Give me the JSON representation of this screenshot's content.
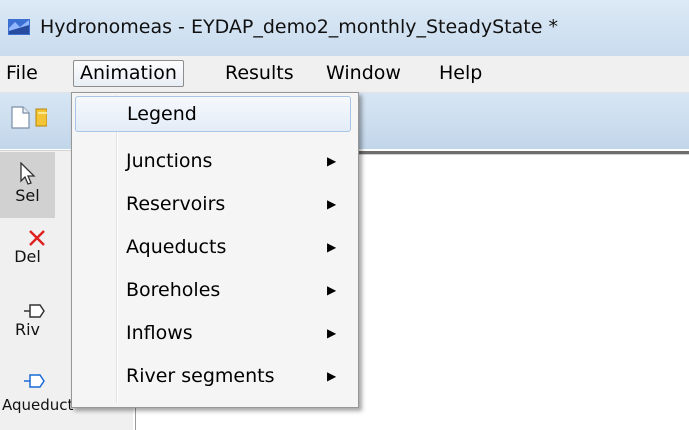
{
  "window": {
    "title": "Hydronomeas - EYDAP_demo2_monthly_SteadyState *",
    "icon": "app-logo-icon"
  },
  "menubar": {
    "items": [
      {
        "label": "File"
      },
      {
        "label": "Animation"
      },
      {
        "label": "Results"
      },
      {
        "label": "Window"
      },
      {
        "label": "Help"
      }
    ],
    "open_menu": "Animation"
  },
  "toolbar": {
    "icons": [
      "new-document-icon",
      "open-folder-icon"
    ]
  },
  "sidebar": {
    "tools": [
      {
        "label": "Sel",
        "icon": "pointer-arrow-icon"
      },
      {
        "label": "Del",
        "icon": "red-x-icon"
      },
      {
        "label": "Riv",
        "icon": "river-node-icon"
      },
      {
        "label": "Aqueduct",
        "icon": "aqueduct-node-icon"
      }
    ]
  },
  "animation_menu": {
    "items": [
      {
        "label": "Legend",
        "submenu": false,
        "highlighted": true
      },
      {
        "label": "Junctions",
        "submenu": true,
        "highlighted": false
      },
      {
        "label": "Reservoirs",
        "submenu": true,
        "highlighted": false
      },
      {
        "label": "Aqueducts",
        "submenu": true,
        "highlighted": false
      },
      {
        "label": "Boreholes",
        "submenu": true,
        "highlighted": false
      },
      {
        "label": "Inflows",
        "submenu": true,
        "highlighted": false
      },
      {
        "label": "River segments",
        "submenu": true,
        "highlighted": false
      }
    ],
    "submenu_arrow": "▶"
  },
  "colors": {
    "titlebar": "#c9dcee",
    "highlight_border": "#a8c5e6",
    "delete_red": "#e02020"
  }
}
